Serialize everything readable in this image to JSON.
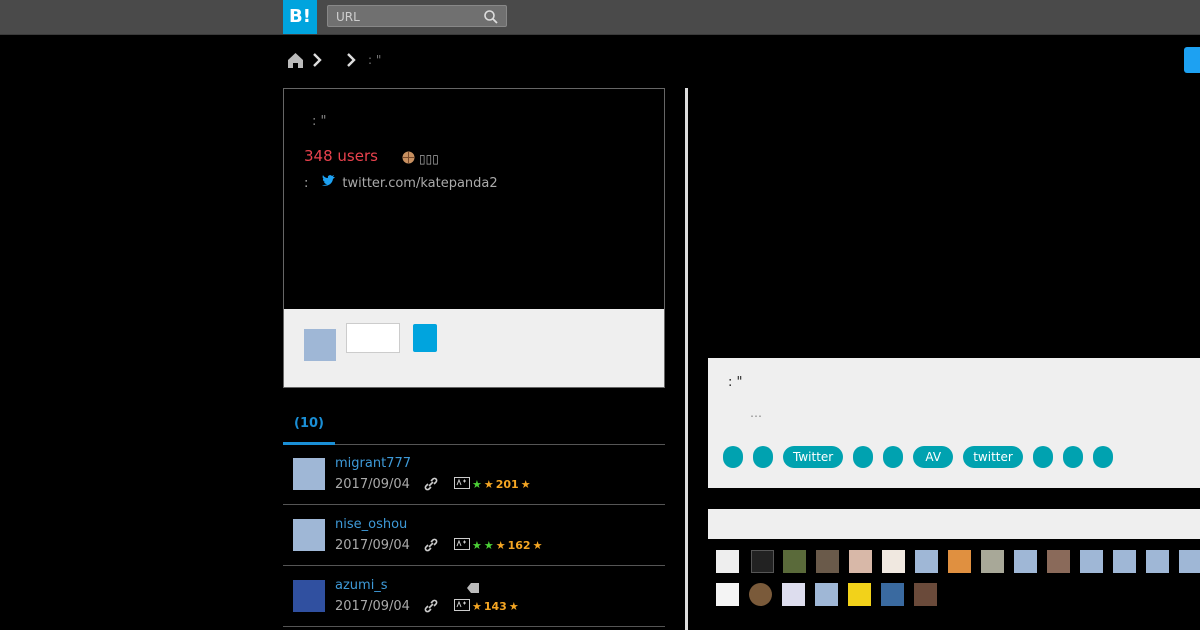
{
  "header": {
    "logo": "B!",
    "search_placeholder": "URL"
  },
  "breadcrumb": {
    "current": ": \""
  },
  "entry": {
    "title": ": \"",
    "users": "348 users",
    "badge_text": "▯▯▯",
    "source_prefix": ":",
    "source_url": "twitter.com/katepanda2"
  },
  "tabs": {
    "active": "(10)"
  },
  "bookmarks": [
    {
      "user": "migrant777",
      "date": "2017/09/04",
      "star_count": "201",
      "green_stars": 1,
      "yellow_stars": 1,
      "tag": false
    },
    {
      "user": "nise_oshou",
      "date": "2017/09/04",
      "star_count": "162",
      "green_stars": 2,
      "yellow_stars": 1,
      "tag": false
    },
    {
      "user": "azumi_s",
      "date": "2017/09/04",
      "star_count": "143",
      "green_stars": 0,
      "yellow_stars": 1,
      "tag": true
    }
  ],
  "side_panel": {
    "title": ": \"",
    "desc": "…",
    "tags": [
      "",
      "",
      "Twitter",
      "",
      "",
      "AV",
      "twitter",
      "",
      "",
      ""
    ]
  },
  "colors": {
    "accent": "#00a4de",
    "users_red": "#e8424d",
    "tag_teal": "#00a2b0",
    "link_blue": "#3e9ad8"
  }
}
